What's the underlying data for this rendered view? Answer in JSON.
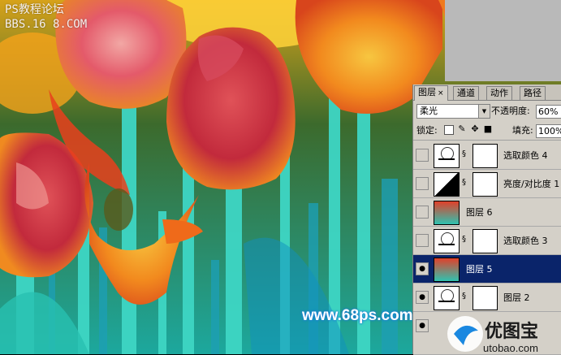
{
  "watermark": {
    "line1": "PS教程论坛",
    "line2": "BBS.16  8.COM",
    "site": "www.68ps.com",
    "logo_text": "优图宝",
    "logo_sub": "utobao.com"
  },
  "panel": {
    "tabs": [
      {
        "label": "图层",
        "close": "×"
      },
      {
        "label": "通道"
      },
      {
        "label": "动作"
      },
      {
        "label": "路径"
      }
    ],
    "blend_mode": "柔光",
    "opacity_label": "不透明度:",
    "opacity_value": "60%",
    "lock_label": "锁定:",
    "fill_label": "填充:",
    "fill_value": "100%",
    "layers": [
      {
        "name": "选取颜色 4",
        "type": "adjustment",
        "visible": false
      },
      {
        "name": "亮度/对比度 1",
        "type": "adjustment",
        "visible": false
      },
      {
        "name": "图层 6",
        "type": "image",
        "visible": false
      },
      {
        "name": "选取颜色 3",
        "type": "adjustment",
        "visible": false
      },
      {
        "name": "图层 5",
        "type": "image",
        "visible": true,
        "selected": true
      },
      {
        "name": "图层 2",
        "type": "adjustment",
        "visible": true
      }
    ]
  },
  "colors": {
    "selection": "#0a246a",
    "panel_bg": "#d4d0c8"
  }
}
